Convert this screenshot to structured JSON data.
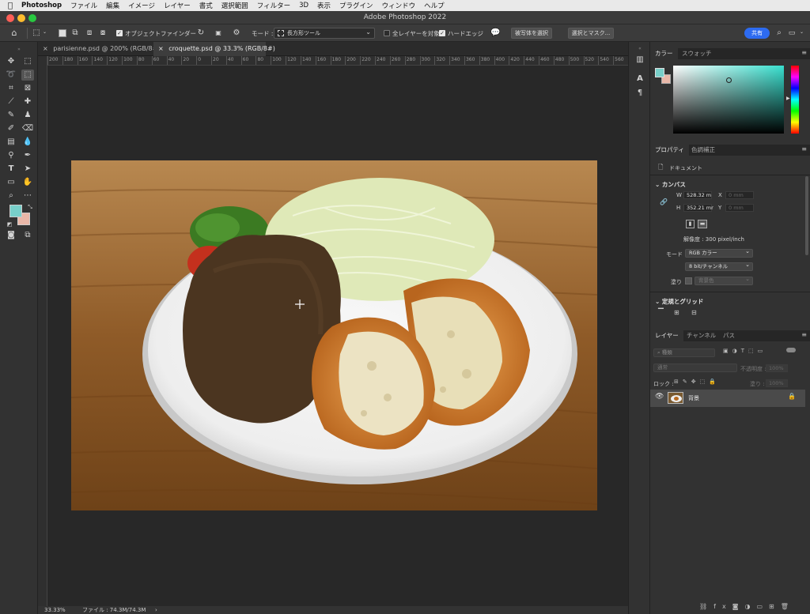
{
  "menubar": {
    "apple_icon": "apple-icon",
    "app_name": "Photoshop",
    "items": [
      "ファイル",
      "編集",
      "イメージ",
      "レイヤー",
      "書式",
      "選択範囲",
      "フィルター",
      "3D",
      "表示",
      "プラグイン",
      "ウィンドウ",
      "ヘルプ"
    ]
  },
  "window": {
    "title": "Adobe Photoshop 2022",
    "traffic_lights": {
      "close": "#fe5f57",
      "minimize": "#febc2e",
      "zoom": "#28c840"
    }
  },
  "options": {
    "auto_select_label": "オブジェクトファインダー",
    "mode_label": "モード :",
    "mode_value": "長方形ツール",
    "all_layers_label": "全レイヤーを対象",
    "hard_edge_label": "ハードエッジ",
    "select_subject_label": "被写体を選択",
    "select_mask_label": "選択とマスク...",
    "share_label": "共有",
    "share_color": "#2d6bf0"
  },
  "tabs": [
    {
      "label": "parisienne.psd @ 200% (RGB/8#)",
      "active": false
    },
    {
      "label": "croquette.psd @ 33.3% (RGB/8#)",
      "active": true
    }
  ],
  "ruler": {
    "ticks": [
      "200",
      "180",
      "160",
      "140",
      "120",
      "100",
      "80",
      "60",
      "40",
      "20",
      "0",
      "20",
      "40",
      "60",
      "80",
      "100",
      "120",
      "140",
      "160",
      "180",
      "200",
      "220",
      "240",
      "260",
      "280",
      "300",
      "320",
      "340",
      "360",
      "380",
      "400",
      "420",
      "440",
      "460",
      "480",
      "500",
      "520",
      "540",
      "560"
    ]
  },
  "status": {
    "zoom": "33.33%",
    "file_info": "ファイル : 74.3M/74.3M",
    "arrow": "›"
  },
  "color_panel": {
    "tabs": [
      "カラー",
      "スウォッチ"
    ],
    "foreground": "#78cfc9",
    "background": "#e9b7a8",
    "hue_color": "#38e0cf"
  },
  "properties": {
    "tabs": [
      "プロパティ",
      "色調補正"
    ],
    "doc_label": "ドキュメント",
    "canvas_title": "カンバス",
    "w_label": "W",
    "w_value": "528.32 m",
    "x_label": "X",
    "x_value": "0 mm",
    "h_label": "H",
    "h_value": "352.21 mr",
    "y_label": "Y",
    "y_value": "0 mm",
    "resolution": "解像度 : 300 pixel/inch",
    "mode_label": "モード",
    "mode_value": "RGB カラー",
    "bit_value": "8 bit/チャンネル",
    "fill_label": "塗り",
    "fill_value": "背景色",
    "rulers_title": "定規とグリッド"
  },
  "layers": {
    "tabs": [
      "レイヤー",
      "チャンネル",
      "パス"
    ],
    "filter_label": "種類",
    "blend_value": "通常",
    "opacity_label": "不透明度 :",
    "opacity_value": "100%",
    "lock_label": "ロック :",
    "fill_label": "塗り :",
    "fill_value": "100%",
    "items": [
      {
        "name": "背景",
        "visible": true,
        "locked": true
      }
    ]
  }
}
